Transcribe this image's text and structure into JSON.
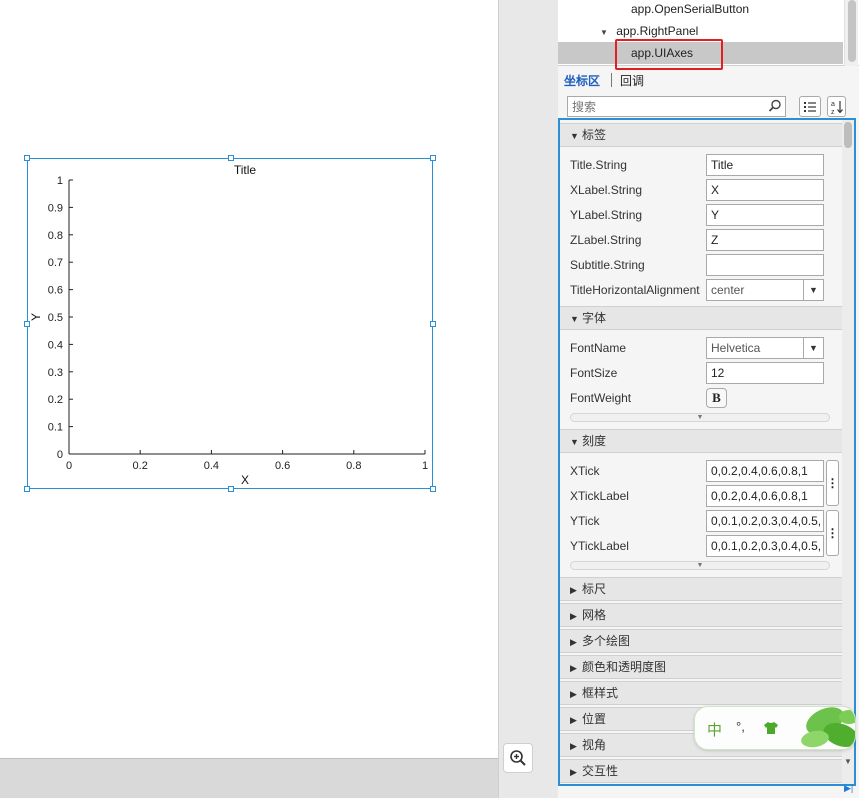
{
  "tree": {
    "items": [
      {
        "label": "app.OpenSerialButton",
        "expanded": null,
        "selected": false
      },
      {
        "label": "app.RightPanel",
        "expanded": true,
        "selected": false
      },
      {
        "label": "app.UIAxes",
        "expanded": null,
        "selected": true
      }
    ]
  },
  "tabs": {
    "properties": "坐标区",
    "callbacks": "回调"
  },
  "search": {
    "placeholder": "搜索",
    "value": ""
  },
  "axes": {
    "title": "Title",
    "xlabel": "X",
    "ylabel": "Y",
    "xticks": [
      "0",
      "0.2",
      "0.4",
      "0.6",
      "0.8",
      "1"
    ],
    "yticks": [
      "0",
      "0.1",
      "0.2",
      "0.3",
      "0.4",
      "0.5",
      "0.6",
      "0.7",
      "0.8",
      "0.9",
      "1"
    ]
  },
  "inspector": {
    "sections": {
      "labels": "标签",
      "font": "字体",
      "ticks": "刻度",
      "rulers": "标尺",
      "grid": "网格",
      "multiple_plots": "多个绘图",
      "color_transparency": "颜色和透明度图",
      "box_style": "框样式",
      "position": "位置",
      "view": "视角",
      "interactivity": "交互性"
    },
    "labels": {
      "title_string": {
        "label": "Title.String",
        "value": "Title"
      },
      "xlabel_string": {
        "label": "XLabel.String",
        "value": "X"
      },
      "ylabel_string": {
        "label": "YLabel.String",
        "value": "Y"
      },
      "zlabel_string": {
        "label": "ZLabel.String",
        "value": "Z"
      },
      "subtitle_string": {
        "label": "Subtitle.String",
        "value": ""
      },
      "title_align": {
        "label": "TitleHorizontalAlignment",
        "value": "center"
      }
    },
    "font": {
      "font_name": {
        "label": "FontName",
        "value": "Helvetica"
      },
      "font_size": {
        "label": "FontSize",
        "value": "12"
      },
      "font_weight": {
        "label": "FontWeight",
        "value": "B"
      }
    },
    "ticks": {
      "xtick": {
        "label": "XTick",
        "value": "0,0.2,0.4,0.6,0.8,1"
      },
      "xticklabel": {
        "label": "XTickLabel",
        "value": "0,0.2,0.4,0.6,0.8,1"
      },
      "ytick": {
        "label": "YTick",
        "value": "0,0.1,0.2,0.3,0.4,0.5,"
      },
      "yticklabel": {
        "label": "YTickLabel",
        "value": "0,0.1,0.2,0.3,0.4,0.5,"
      }
    }
  },
  "ime": {
    "mode": "中",
    "punct": "°,"
  },
  "colors": {
    "selection_blue": "#2b8fd6",
    "highlight_red": "#e02020",
    "tab_active": "#1f5fbf"
  }
}
